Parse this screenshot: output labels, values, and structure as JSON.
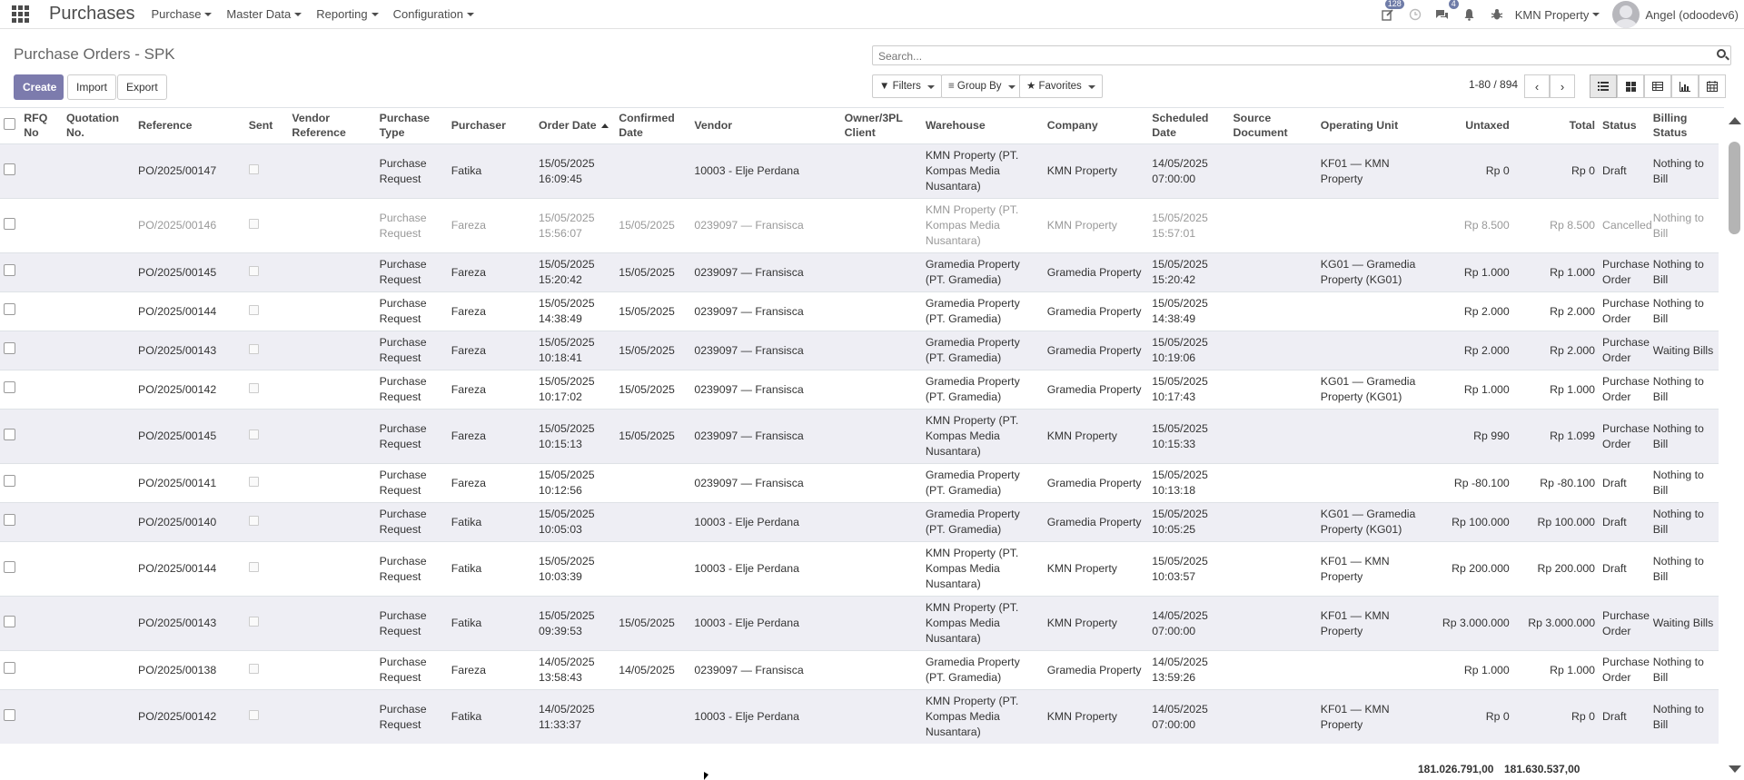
{
  "navbar": {
    "brand": "Purchases",
    "menus": [
      "Purchase",
      "Master Data",
      "Reporting",
      "Configuration"
    ],
    "activity_badge": "128",
    "messages_badge": "4",
    "company": "KMN Property",
    "user": "Angel (odoodev6)"
  },
  "control_panel": {
    "title": "Purchase Orders - SPK",
    "create_label": "Create",
    "import_label": "Import",
    "export_label": "Export",
    "search_placeholder": "Search...",
    "filters_label": "Filters",
    "group_by_label": "Group By",
    "favorites_label": "Favorites",
    "pager": "1-80 / 894"
  },
  "table": {
    "headers": [
      {
        "key": "rfq",
        "label": "RFQ No"
      },
      {
        "key": "quot",
        "label": "Quotation No."
      },
      {
        "key": "ref",
        "label": "Reference"
      },
      {
        "key": "sent",
        "label": "Sent"
      },
      {
        "key": "vref",
        "label": "Vendor Reference"
      },
      {
        "key": "ptype",
        "label": "Purchase Type"
      },
      {
        "key": "purchaser",
        "label": "Purchaser"
      },
      {
        "key": "odate",
        "label": "Order Date"
      },
      {
        "key": "cdate",
        "label": "Confirmed Date"
      },
      {
        "key": "vendor",
        "label": "Vendor"
      },
      {
        "key": "owner",
        "label": "Owner/3PL Client"
      },
      {
        "key": "warehouse",
        "label": "Warehouse"
      },
      {
        "key": "company",
        "label": "Company"
      },
      {
        "key": "sdate",
        "label": "Scheduled Date"
      },
      {
        "key": "source",
        "label": "Source Document"
      },
      {
        "key": "ou",
        "label": "Operating Unit"
      },
      {
        "key": "untaxed",
        "label": "Untaxed"
      },
      {
        "key": "total",
        "label": "Total"
      },
      {
        "key": "status",
        "label": "Status"
      },
      {
        "key": "billing",
        "label": "Billing Status"
      }
    ],
    "rows": [
      {
        "ref": "PO/2025/00147",
        "ptype": "Purchase Request",
        "purchaser": "Fatika",
        "odate": "15/05/2025 16:09:45",
        "cdate": "",
        "vendor": "10003 - Elje Perdana",
        "warehouse": "KMN Property (PT. Kompas Media Nusantara)",
        "company": "KMN Property",
        "sdate": "14/05/2025 07:00:00",
        "ou": "KF01 — KMN Property",
        "untaxed": "Rp 0",
        "total": "Rp 0",
        "status": "Draft",
        "billing": "Nothing to Bill",
        "cancelled": false
      },
      {
        "ref": "PO/2025/00146",
        "ptype": "Purchase Request",
        "purchaser": "Fareza",
        "odate": "15/05/2025 15:56:07",
        "cdate": "15/05/2025",
        "vendor": "0239097 — Fransisca",
        "warehouse": "KMN Property (PT. Kompas Media Nusantara)",
        "company": "KMN Property",
        "sdate": "15/05/2025 15:57:01",
        "ou": "",
        "untaxed": "Rp 8.500",
        "total": "Rp 8.500",
        "status": "Cancelled",
        "billing": "Nothing to Bill",
        "cancelled": true
      },
      {
        "ref": "PO/2025/00145",
        "ptype": "Purchase Request",
        "purchaser": "Fareza",
        "odate": "15/05/2025 15:20:42",
        "cdate": "15/05/2025",
        "vendor": "0239097 — Fransisca",
        "warehouse": "Gramedia Property (PT. Gramedia)",
        "company": "Gramedia Property",
        "sdate": "15/05/2025 15:20:42",
        "ou": "KG01 — Gramedia Property (KG01)",
        "untaxed": "Rp 1.000",
        "total": "Rp 1.000",
        "status": "Purchase Order",
        "billing": "Nothing to Bill",
        "cancelled": false
      },
      {
        "ref": "PO/2025/00144",
        "ptype": "Purchase Request",
        "purchaser": "Fareza",
        "odate": "15/05/2025 14:38:49",
        "cdate": "15/05/2025",
        "vendor": "0239097 — Fransisca",
        "warehouse": "Gramedia Property (PT. Gramedia)",
        "company": "Gramedia Property",
        "sdate": "15/05/2025 14:38:49",
        "ou": "",
        "untaxed": "Rp 2.000",
        "total": "Rp 2.000",
        "status": "Purchase Order",
        "billing": "Nothing to Bill",
        "cancelled": false
      },
      {
        "ref": "PO/2025/00143",
        "ptype": "Purchase Request",
        "purchaser": "Fareza",
        "odate": "15/05/2025 10:18:41",
        "cdate": "15/05/2025",
        "vendor": "0239097 — Fransisca",
        "warehouse": "Gramedia Property (PT. Gramedia)",
        "company": "Gramedia Property",
        "sdate": "15/05/2025 10:19:06",
        "ou": "",
        "untaxed": "Rp 2.000",
        "total": "Rp 2.000",
        "status": "Purchase Order",
        "billing": "Waiting Bills",
        "cancelled": false
      },
      {
        "ref": "PO/2025/00142",
        "ptype": "Purchase Request",
        "purchaser": "Fareza",
        "odate": "15/05/2025 10:17:02",
        "cdate": "15/05/2025",
        "vendor": "0239097 — Fransisca",
        "warehouse": "Gramedia Property (PT. Gramedia)",
        "company": "Gramedia Property",
        "sdate": "15/05/2025 10:17:43",
        "ou": "KG01 — Gramedia Property (KG01)",
        "untaxed": "Rp 1.000",
        "total": "Rp 1.000",
        "status": "Purchase Order",
        "billing": "Nothing to Bill",
        "cancelled": false
      },
      {
        "ref": "PO/2025/00145",
        "ptype": "Purchase Request",
        "purchaser": "Fareza",
        "odate": "15/05/2025 10:15:13",
        "cdate": "15/05/2025",
        "vendor": "0239097 — Fransisca",
        "warehouse": "KMN Property (PT. Kompas Media Nusantara)",
        "company": "KMN Property",
        "sdate": "15/05/2025 10:15:33",
        "ou": "",
        "untaxed": "Rp 990",
        "total": "Rp 1.099",
        "status": "Purchase Order",
        "billing": "Nothing to Bill",
        "cancelled": false
      },
      {
        "ref": "PO/2025/00141",
        "ptype": "Purchase Request",
        "purchaser": "Fareza",
        "odate": "15/05/2025 10:12:56",
        "cdate": "",
        "vendor": "0239097 — Fransisca",
        "warehouse": "Gramedia Property (PT. Gramedia)",
        "company": "Gramedia Property",
        "sdate": "15/05/2025 10:13:18",
        "ou": "",
        "untaxed": "Rp -80.100",
        "total": "Rp -80.100",
        "status": "Draft",
        "billing": "Nothing to Bill",
        "cancelled": false
      },
      {
        "ref": "PO/2025/00140",
        "ptype": "Purchase Request",
        "purchaser": "Fatika",
        "odate": "15/05/2025 10:05:03",
        "cdate": "",
        "vendor": "10003 - Elje Perdana",
        "warehouse": "Gramedia Property (PT. Gramedia)",
        "company": "Gramedia Property",
        "sdate": "15/05/2025 10:05:25",
        "ou": "KG01 — Gramedia Property (KG01)",
        "untaxed": "Rp 100.000",
        "total": "Rp 100.000",
        "status": "Draft",
        "billing": "Nothing to Bill",
        "cancelled": false
      },
      {
        "ref": "PO/2025/00144",
        "ptype": "Purchase Request",
        "purchaser": "Fatika",
        "odate": "15/05/2025 10:03:39",
        "cdate": "",
        "vendor": "10003 - Elje Perdana",
        "warehouse": "KMN Property (PT. Kompas Media Nusantara)",
        "company": "KMN Property",
        "sdate": "15/05/2025 10:03:57",
        "ou": "KF01 — KMN Property",
        "untaxed": "Rp 200.000",
        "total": "Rp 200.000",
        "status": "Draft",
        "billing": "Nothing to Bill",
        "cancelled": false
      },
      {
        "ref": "PO/2025/00143",
        "ptype": "Purchase Request",
        "purchaser": "Fatika",
        "odate": "15/05/2025 09:39:53",
        "cdate": "15/05/2025",
        "vendor": "10003 - Elje Perdana",
        "warehouse": "KMN Property (PT. Kompas Media Nusantara)",
        "company": "KMN Property",
        "sdate": "14/05/2025 07:00:00",
        "ou": "KF01 — KMN Property",
        "untaxed": "Rp 3.000.000",
        "total": "Rp 3.000.000",
        "status": "Purchase Order",
        "billing": "Waiting Bills",
        "cancelled": false
      },
      {
        "ref": "PO/2025/00138",
        "ptype": "Purchase Request",
        "purchaser": "Fareza",
        "odate": "14/05/2025 13:58:43",
        "cdate": "14/05/2025",
        "vendor": "0239097 — Fransisca",
        "warehouse": "Gramedia Property (PT. Gramedia)",
        "company": "Gramedia Property",
        "sdate": "14/05/2025 13:59:26",
        "ou": "",
        "untaxed": "Rp 1.000",
        "total": "Rp 1.000",
        "status": "Purchase Order",
        "billing": "Nothing to Bill",
        "cancelled": false
      },
      {
        "ref": "PO/2025/00142",
        "ptype": "Purchase Request",
        "purchaser": "Fatika",
        "odate": "14/05/2025 11:33:37",
        "cdate": "",
        "vendor": "10003 - Elje Perdana",
        "warehouse": "KMN Property (PT. Kompas Media Nusantara)",
        "company": "KMN Property",
        "sdate": "14/05/2025 07:00:00",
        "ou": "KF01 — KMN Property",
        "untaxed": "Rp 0",
        "total": "Rp 0",
        "status": "Draft",
        "billing": "Nothing to Bill",
        "cancelled": false
      }
    ],
    "total_untaxed": "181.026.791,00",
    "total_amount": "181.630.537,00"
  }
}
